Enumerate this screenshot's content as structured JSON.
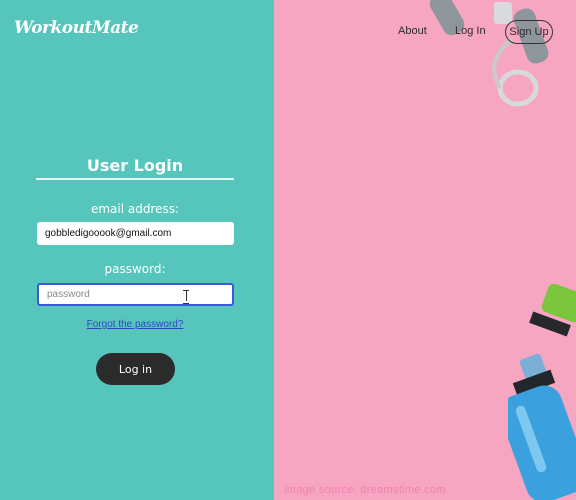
{
  "brand": {
    "logo_text": "WorkoutMate"
  },
  "nav": {
    "about": "About",
    "login": "Log In",
    "signup": "Sign Up"
  },
  "login_form": {
    "title": "User Login",
    "email_label": "email address:",
    "email_value": "gobbledigooook@gmail.com",
    "password_label": "password:",
    "password_placeholder": "password",
    "forgot_link": "Forgot the password?",
    "submit_label": "Log in"
  },
  "hero": {
    "image_source": "image source: dreamstime.com"
  },
  "colors": {
    "left_panel": "#56c6bd",
    "right_panel": "#f7a6c1",
    "button": "#2b2b2b",
    "link": "#3344c8",
    "focus_border": "#3b5bd6"
  }
}
